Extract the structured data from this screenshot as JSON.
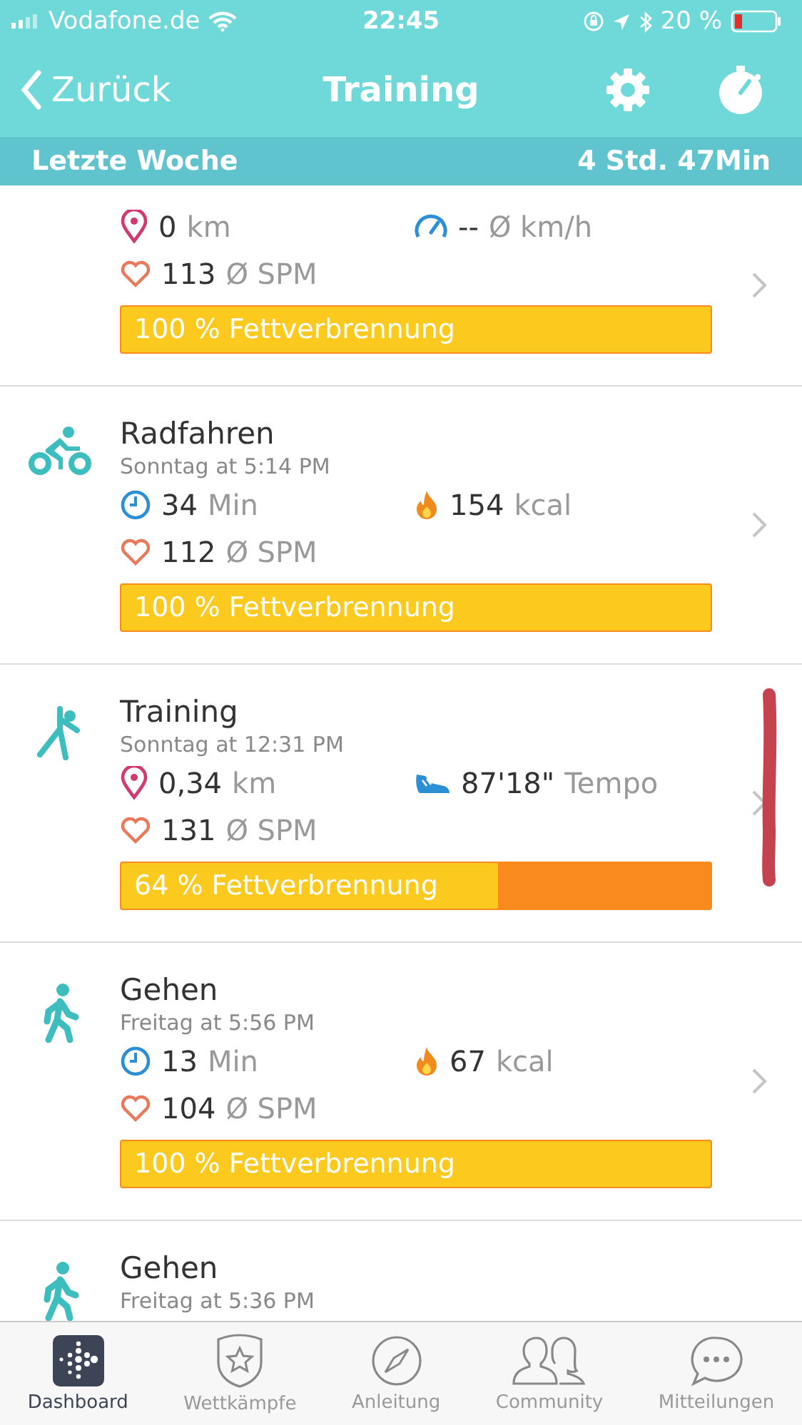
{
  "status_bar": {
    "carrier": "Vodafone.de",
    "time": "22:45",
    "battery": "20 %"
  },
  "nav": {
    "back": "Zurück",
    "title": "Training"
  },
  "summary": {
    "label": "Letzte Woche",
    "total": "4 Std. 47Min"
  },
  "activities": [
    {
      "stats": [
        {
          "kind": "distance",
          "value": "0",
          "unit": "km"
        },
        {
          "kind": "speed",
          "value": "--",
          "unit": "Ø km/h"
        }
      ],
      "heart": {
        "value": "113",
        "unit": "Ø SPM"
      },
      "burn": {
        "level": 1,
        "label": "100 % Fettverbrennung"
      }
    },
    {
      "kind": "bike",
      "title": "Radfahren",
      "subtitle": "Sonntag at 5:14 PM",
      "stats": [
        {
          "kind": "duration",
          "value": "34",
          "unit": "Min"
        },
        {
          "kind": "calories",
          "value": "154",
          "unit": "kcal"
        }
      ],
      "heart": {
        "value": "112",
        "unit": "Ø SPM"
      },
      "burn": {
        "level": 1,
        "label": "100 % Fettverbrennung"
      }
    },
    {
      "kind": "workout",
      "title": "Training",
      "subtitle": "Sonntag at 12:31 PM",
      "stats": [
        {
          "kind": "distance",
          "value": "0,34",
          "unit": "km"
        },
        {
          "kind": "pace",
          "value": "87'18\"",
          "unit": "Tempo"
        }
      ],
      "heart": {
        "value": "131",
        "unit": "Ø SPM"
      },
      "burn": {
        "level": 0.64,
        "label": "64 % Fettverbrennung"
      }
    },
    {
      "kind": "walk",
      "title": "Gehen",
      "subtitle": "Freitag at 5:56 PM",
      "stats": [
        {
          "kind": "duration",
          "value": "13",
          "unit": "Min"
        },
        {
          "kind": "calories",
          "value": "67",
          "unit": "kcal"
        }
      ],
      "heart": {
        "value": "104",
        "unit": "Ø SPM"
      },
      "burn": {
        "level": 1,
        "label": "100 % Fettverbrennung"
      }
    },
    {
      "kind": "walk",
      "title": "Gehen",
      "subtitle": "Freitag at 5:36 PM"
    }
  ],
  "tabs": [
    {
      "kind": "dashboard",
      "label": "Dashboard",
      "selected": true
    },
    {
      "kind": "challenges",
      "label": "Wettkämpfe",
      "selected": false
    },
    {
      "kind": "guide",
      "label": "Anleitung",
      "selected": false
    },
    {
      "kind": "community",
      "label": "Community",
      "selected": false
    },
    {
      "kind": "messages",
      "label": "Mitteilungen",
      "selected": false
    }
  ]
}
